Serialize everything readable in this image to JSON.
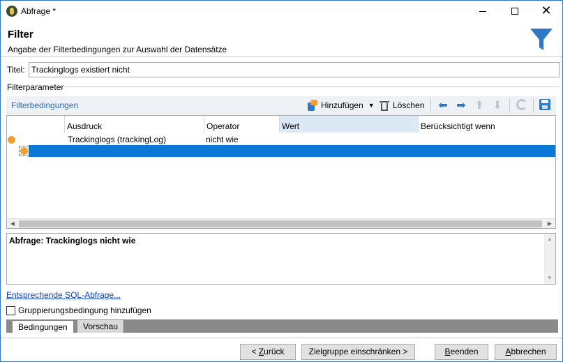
{
  "window": {
    "title": "Abfrage *",
    "controls": {
      "minimize": "",
      "maximize": "",
      "close": "✕"
    }
  },
  "header": {
    "title": "Filter",
    "subtitle": "Angabe der Filterbedingungen zur Auswahl der Datensätze"
  },
  "title_field": {
    "label": "Titel:",
    "value": "Trackinglogs existiert nicht"
  },
  "section": {
    "label": "Filterparameter"
  },
  "toolbar": {
    "title": "Filterbedingungen",
    "add_label": "Hinzufügen",
    "delete_label": "Löschen"
  },
  "grid": {
    "columns": [
      "Ausdruck",
      "Operator",
      "Wert",
      "Berücksichtigt wenn"
    ],
    "selected_column": "Wert",
    "rows": [
      {
        "expression": "Trackinglogs (trackingLog)",
        "operator": "nicht wie",
        "value": "",
        "condition": ""
      }
    ]
  },
  "description": {
    "text": "Abfrage: Trackinglogs nicht wie"
  },
  "links": {
    "sql": "Entsprechende SQL-Abfrage..."
  },
  "checkbox": {
    "label": "Gruppierungsbedingung hinzufügen",
    "checked": false
  },
  "tabs": [
    {
      "label": "Bedingungen",
      "active": true
    },
    {
      "label": "Vorschau",
      "active": false
    }
  ],
  "buttons": {
    "back_prefix": "< ",
    "back_mnemonic": "Z",
    "back_rest": "urück",
    "next": "Zielgruppe einschränken >",
    "finish_mnemonic": "B",
    "finish_rest": "eenden",
    "cancel_mnemonic": "A",
    "cancel_rest": "bbrechen"
  },
  "colors": {
    "accent": "#2e78c8",
    "selection": "#0a78d7",
    "condition_dot": "#f0a030",
    "column_highlight": "#dbe9f7"
  }
}
